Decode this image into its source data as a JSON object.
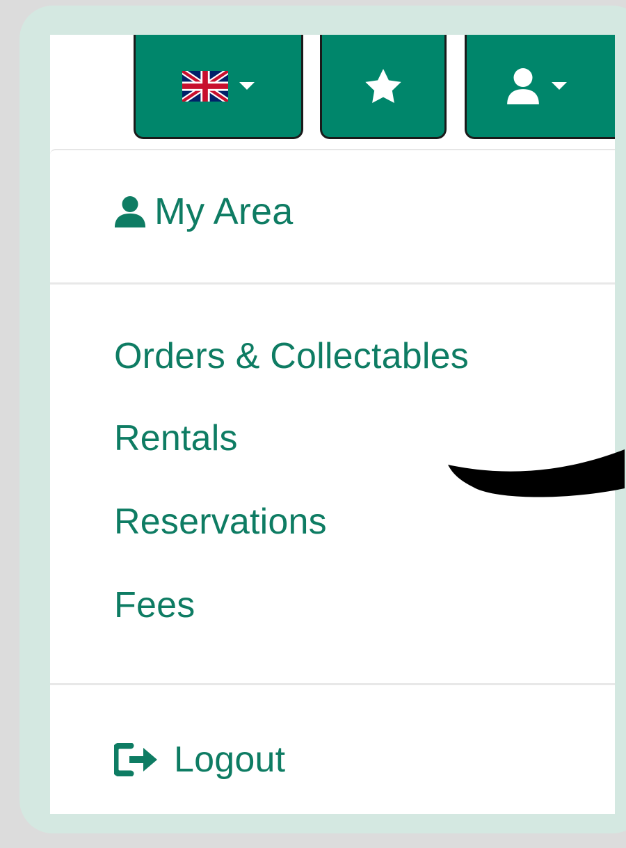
{
  "colors": {
    "accent": "#00866b",
    "link": "#0e7c63",
    "frame": "#d4e8e1"
  },
  "toolbar": {
    "language_button_icon": "uk-flag-icon",
    "favorites_button_icon": "star-icon",
    "account_button_icon": "user-icon"
  },
  "menu": {
    "header": "My Area",
    "items": [
      {
        "label": "Orders & Collectables"
      },
      {
        "label": "Rentals"
      },
      {
        "label": "Reservations"
      },
      {
        "label": "Fees"
      }
    ],
    "logout": "Logout"
  }
}
